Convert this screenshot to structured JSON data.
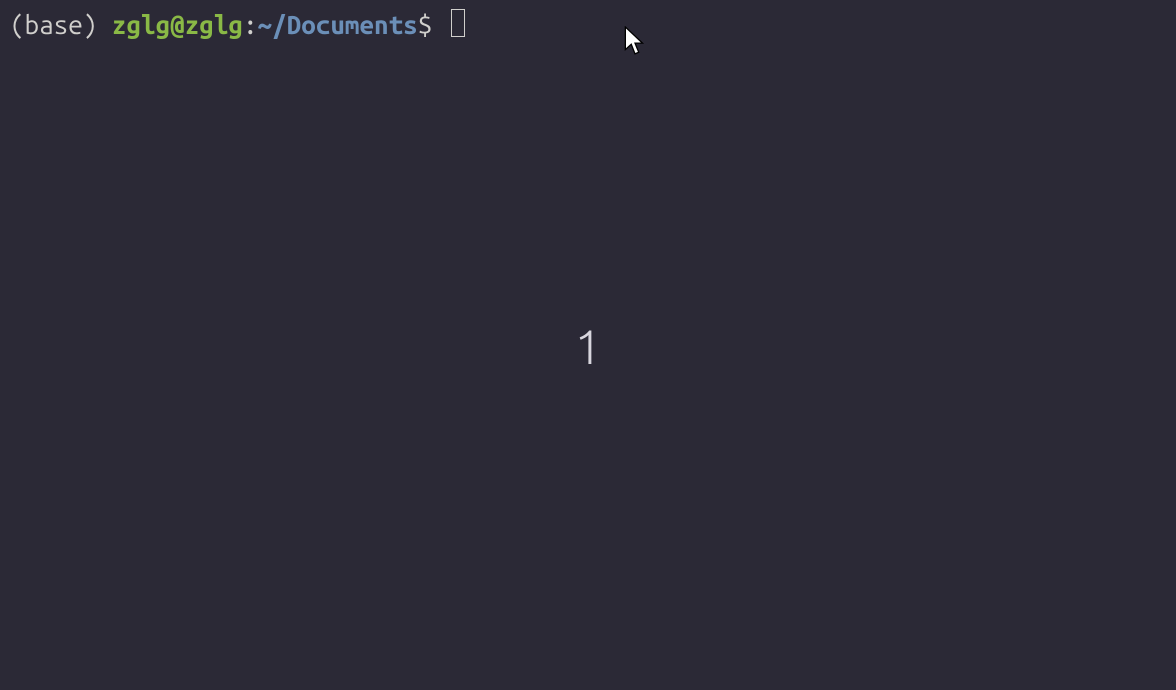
{
  "prompt": {
    "env_prefix": "(base) ",
    "user_host": "zglg@zglg",
    "colon": ":",
    "path": "~/Documents",
    "dollar": "$ "
  },
  "workspace": {
    "number": "1"
  }
}
